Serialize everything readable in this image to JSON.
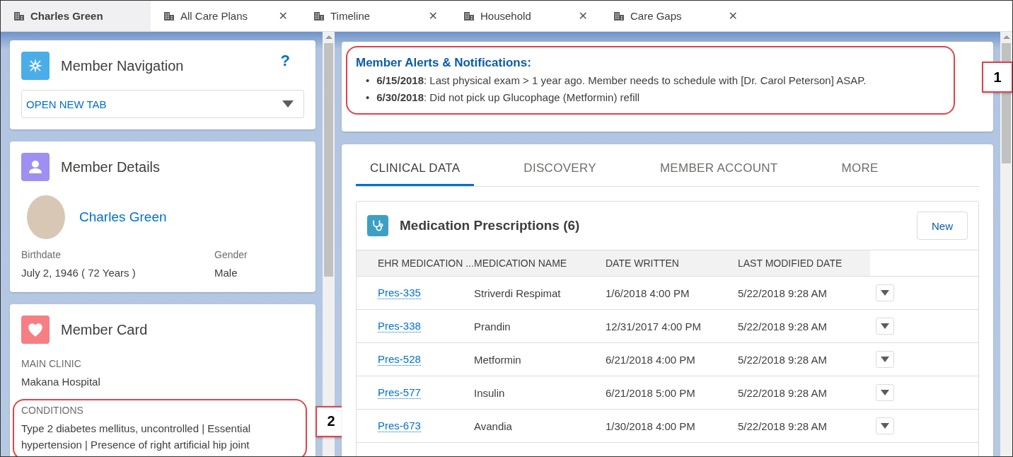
{
  "tabs": [
    {
      "label": "Charles Green",
      "selected": true,
      "closable": false
    },
    {
      "label": "All Care Plans",
      "selected": false,
      "closable": true
    },
    {
      "label": "Timeline",
      "selected": false,
      "closable": true
    },
    {
      "label": "Household",
      "selected": false,
      "closable": true
    },
    {
      "label": "Care Gaps",
      "selected": false,
      "closable": true
    }
  ],
  "close_glyph": "✕",
  "member_navigation": {
    "title": "Member Navigation",
    "help": "?",
    "dropdown": {
      "value": "OPEN NEW TAB"
    }
  },
  "member_details": {
    "title": "Member Details",
    "name": "Charles Green",
    "fields": [
      {
        "label": "Birthdate",
        "value": "July 2, 1946 ( 72 Years )"
      },
      {
        "label": "Gender",
        "value": "Male"
      }
    ]
  },
  "member_card": {
    "title": "Member Card",
    "fields": [
      {
        "label": "MAIN CLINIC",
        "value": "Makana Hospital"
      },
      {
        "label": "CONDITIONS",
        "value": "Type 2 diabetes mellitus, uncontrolled | Essential hypertension | Presence of right artificial hip joint",
        "highlighted": true,
        "callout": "2"
      }
    ]
  },
  "alerts": {
    "title": "Member Alerts & Notifications:",
    "bullet": "•",
    "highlighted": true,
    "callout": "1",
    "items": [
      {
        "date": "6/15/2018",
        "text": ": Last physical exam > 1 year ago. Member needs to schedule with [Dr. Carol Peterson] ASAP."
      },
      {
        "date": "6/30/2018",
        "text": ": Did not pick up Glucophage (Metformin) refill"
      }
    ]
  },
  "content_tabs": [
    {
      "label": "CLINICAL DATA",
      "selected": true
    },
    {
      "label": "DISCOVERY",
      "selected": false
    },
    {
      "label": "MEMBER ACCOUNT",
      "selected": false
    },
    {
      "label": "MORE",
      "selected": false
    }
  ],
  "prescriptions": {
    "title": "Medication Prescriptions (6)",
    "new_button": "New",
    "columns": [
      "EHR MEDICATION ...",
      "MEDICATION NAME",
      "DATE WRITTEN",
      "LAST MODIFIED DATE"
    ],
    "rows": [
      [
        "Pres-335",
        "Striverdi Respimat",
        "1/6/2018 4:00 PM",
        "5/22/2018 9:28 AM"
      ],
      [
        "Pres-338",
        "Prandin",
        "12/31/2017 4:00 PM",
        "5/22/2018 9:28 AM"
      ],
      [
        "Pres-528",
        "Metformin",
        "6/21/2018 4:00 PM",
        "5/22/2018 9:28 AM"
      ],
      [
        "Pres-577",
        "Insulin",
        "6/21/2018 5:00 PM",
        "5/22/2018 9:28 AM"
      ],
      [
        "Pres-673",
        "Avandia",
        "1/30/2018 4:00 PM",
        "5/22/2018 9:28 AM"
      ]
    ]
  }
}
